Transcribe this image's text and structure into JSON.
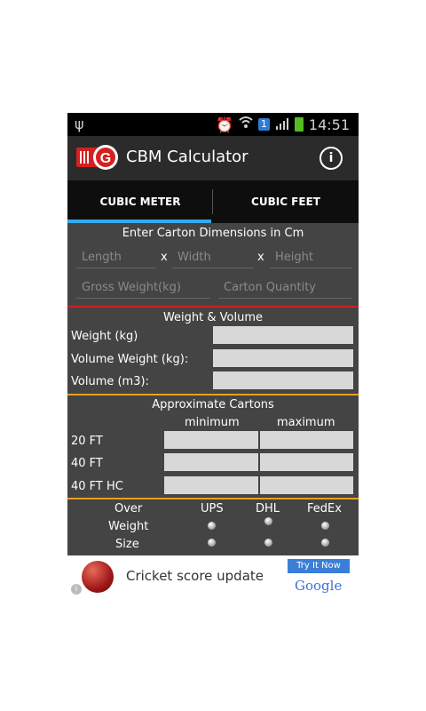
{
  "status_bar": {
    "time": "14:51",
    "sim_slot": "1"
  },
  "app": {
    "title": "CBM Calculator",
    "info_label": "i"
  },
  "tabs": [
    {
      "label": "CUBIC METER",
      "selected": true
    },
    {
      "label": "CUBIC FEET",
      "selected": false
    }
  ],
  "dimensions": {
    "title": "Enter Carton Dimensions in Cm",
    "separator": "x",
    "length_placeholder": "Length",
    "width_placeholder": "Width",
    "height_placeholder": "Height",
    "gross_weight_placeholder": "Gross Weight(kg)",
    "carton_quantity_placeholder": "Carton Quantity"
  },
  "weight_volume": {
    "title": "Weight & Volume",
    "rows": [
      {
        "label": "Weight (kg)",
        "value": ""
      },
      {
        "label": "Volume Weight (kg):",
        "value": ""
      },
      {
        "label": "Volume (m3):",
        "value": ""
      }
    ]
  },
  "cartons": {
    "title": "Approximate Cartons",
    "min_label": "minimum",
    "max_label": "maximum",
    "rows": [
      {
        "label": "20 FT",
        "min": "",
        "max": ""
      },
      {
        "label": "40 FT",
        "min": "",
        "max": ""
      },
      {
        "label": "40 FT HC",
        "min": "",
        "max": ""
      }
    ]
  },
  "couriers": {
    "header": "Over",
    "columns": [
      "UPS",
      "DHL",
      "FedEx"
    ],
    "rows": [
      "Weight",
      "Size"
    ]
  },
  "ad": {
    "text": "Cricket score update",
    "button": "Try It Now",
    "brand": "Google",
    "info": "i"
  },
  "colors": {
    "tab_indicator": "#33aaee",
    "divider_red": "#cc2222",
    "divider_orange": "#e8a020",
    "brand_red": "#d42020"
  }
}
